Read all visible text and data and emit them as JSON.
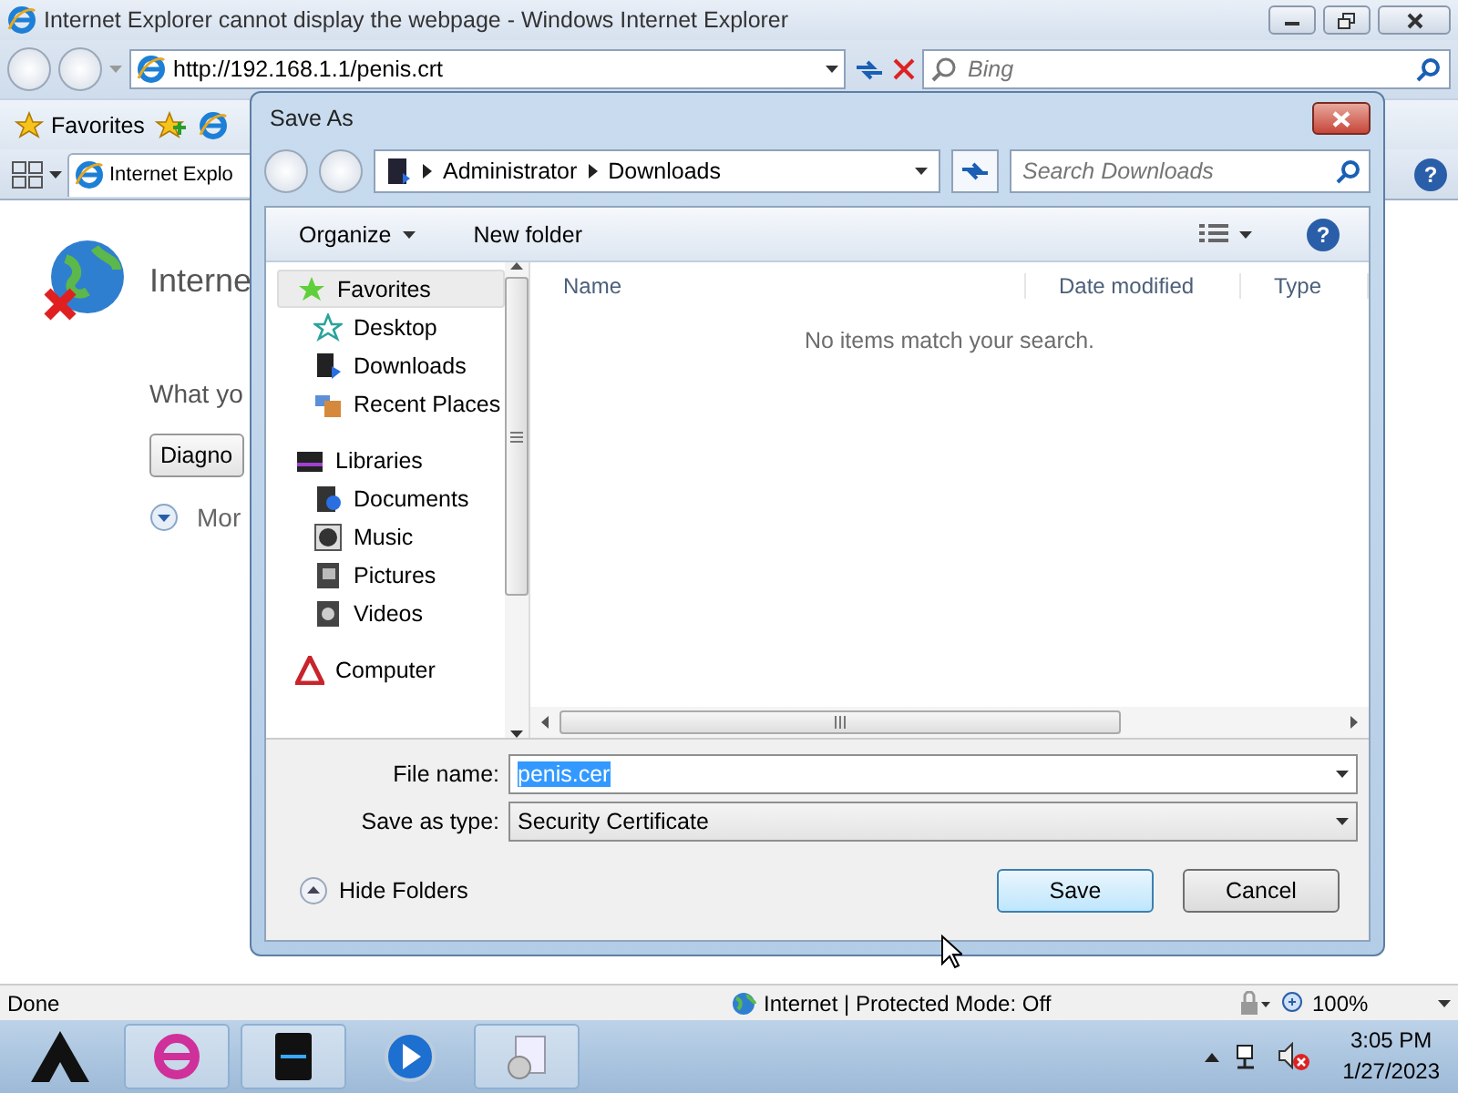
{
  "window": {
    "title": "Internet Explorer cannot display the webpage - Windows Internet Explorer"
  },
  "address_bar": {
    "url": "http://192.168.1.1/penis.crt"
  },
  "search": {
    "placeholder": "Bing"
  },
  "favorites_bar": {
    "label": "Favorites"
  },
  "tab": {
    "label": "Internet Explo",
    "selected": true
  },
  "help_button": {
    "label": "?"
  },
  "page": {
    "heading": "Interne",
    "text": "What yo",
    "button": "Diagno",
    "more": "Mor"
  },
  "dialog": {
    "title": "Save As",
    "breadcrumb": [
      "Administrator",
      "Downloads"
    ],
    "search": {
      "placeholder": "Search Downloads"
    },
    "toolbar": [
      {
        "label": "Organize",
        "kind": "menu"
      },
      {
        "label": "New folder",
        "kind": "button"
      }
    ],
    "help_button": {
      "label": "?"
    },
    "nav_tree": [
      {
        "label": "Favorites",
        "selected": true,
        "children": [
          {
            "label": "Desktop",
            "selected": false
          },
          {
            "label": "Downloads",
            "selected": false
          },
          {
            "label": "Recent Places",
            "selected": false
          }
        ]
      },
      {
        "label": "Libraries",
        "selected": false,
        "children": [
          {
            "label": "Documents",
            "selected": false
          },
          {
            "label": "Music",
            "selected": false
          },
          {
            "label": "Pictures",
            "selected": false
          },
          {
            "label": "Videos",
            "selected": false
          }
        ]
      },
      {
        "label": "Computer",
        "selected": false
      }
    ],
    "columns": [
      "Name",
      "Date modified",
      "Type"
    ],
    "empty_message": "No items match your search.",
    "file_name": {
      "label": "File name:",
      "value": "penis.cer",
      "text_selected": true
    },
    "save_type": {
      "label": "Save as type:",
      "value": "Security Certificate"
    },
    "hide_folders": "Hide Folders",
    "buttons": [
      {
        "label": "Save",
        "default": true
      },
      {
        "label": "Cancel",
        "default": false
      }
    ]
  },
  "status_bar": {
    "text": "Done",
    "zone": "Internet | Protected Mode: Off",
    "zoom": "100%"
  },
  "taskbar": {
    "time": "3:05 PM",
    "date": "1/27/2023"
  }
}
